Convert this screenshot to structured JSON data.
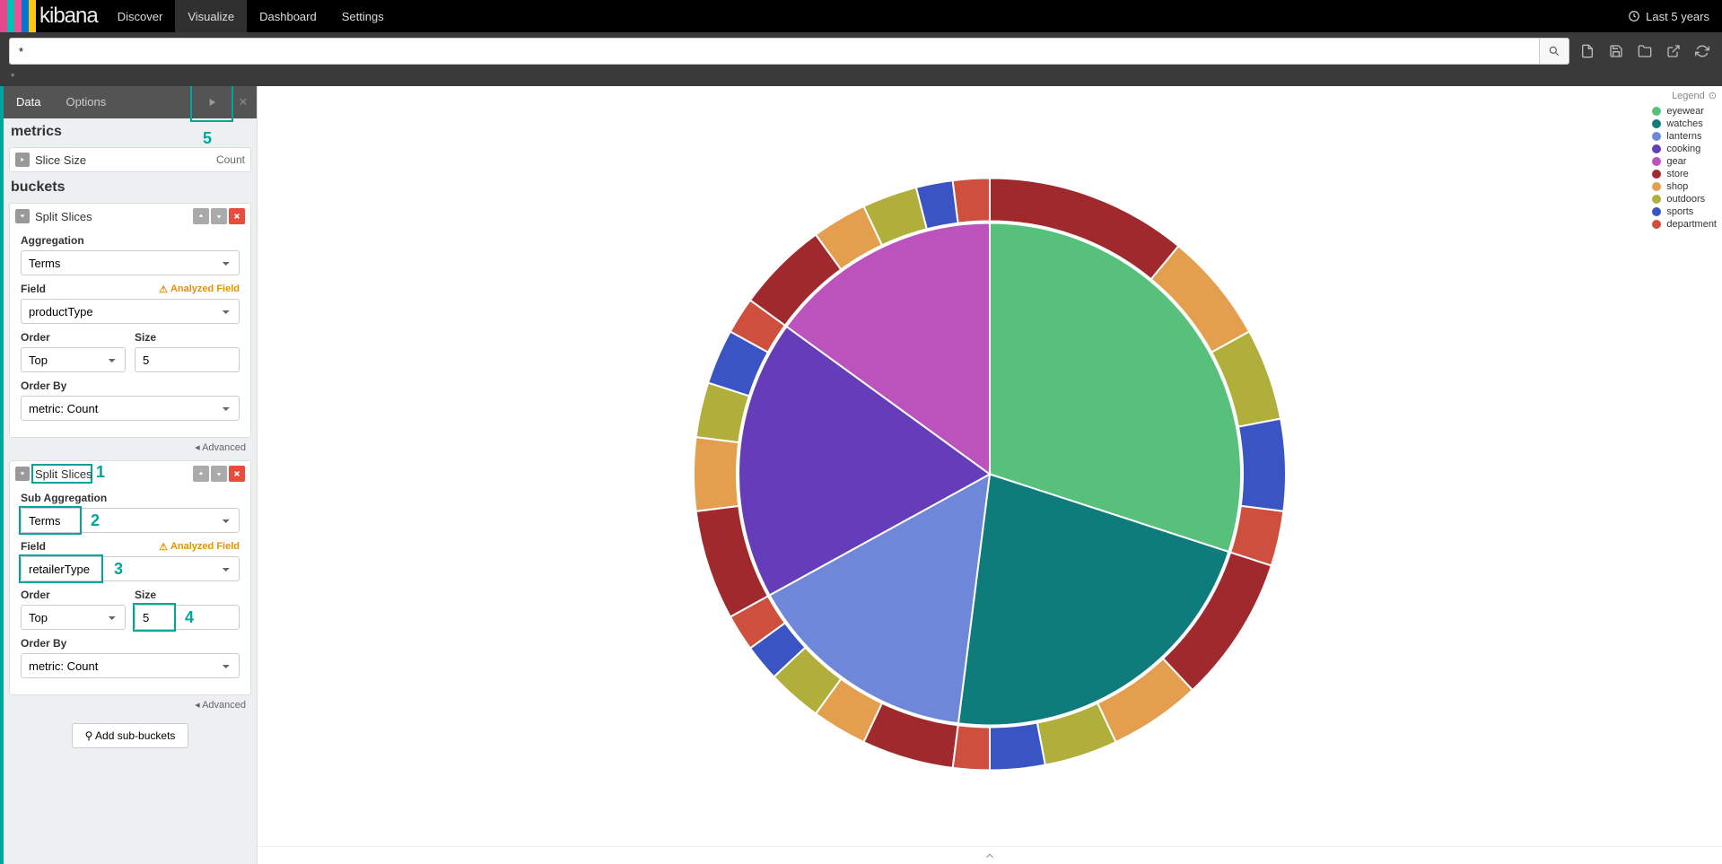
{
  "nav": {
    "items": [
      "Discover",
      "Visualize",
      "Dashboard",
      "Settings"
    ],
    "active": 1,
    "time_label": "Last 5 years"
  },
  "search": {
    "query": "*",
    "placeholder": ""
  },
  "label": "*",
  "side_tabs": {
    "data": "Data",
    "options": "Options"
  },
  "metrics": {
    "header": "metrics",
    "slice_size": "Slice Size",
    "count": "Count"
  },
  "buckets": {
    "header": "buckets",
    "agg1": {
      "title": "Split Slices",
      "aggregation_label": "Aggregation",
      "aggregation": "Terms",
      "field_label": "Field",
      "field_warning": "Analyzed Field",
      "field": "productType",
      "order_label": "Order",
      "order": "Top",
      "size_label": "Size",
      "size": "5",
      "orderby_label": "Order By",
      "orderby": "metric: Count",
      "advanced": "Advanced"
    },
    "agg2": {
      "title": "Split Slices",
      "aggregation_label": "Sub Aggregation",
      "aggregation": "Terms",
      "field_label": "Field",
      "field_warning": "Analyzed Field",
      "field": "retailerType",
      "order_label": "Order",
      "order": "Top",
      "size_label": "Size",
      "size": "5",
      "orderby_label": "Order By",
      "orderby": "metric: Count",
      "advanced": "Advanced"
    },
    "add_sub": "Add sub-buckets"
  },
  "legend": {
    "title": "Legend",
    "items": [
      {
        "label": "eyewear",
        "color": "#57c17b"
      },
      {
        "label": "watches",
        "color": "#0e7c7b"
      },
      {
        "label": "lanterns",
        "color": "#6f87d8"
      },
      {
        "label": "cooking",
        "color": "#663db8"
      },
      {
        "label": "gear",
        "color": "#bc52bc"
      },
      {
        "label": "store",
        "color": "#a0292e"
      },
      {
        "label": "shop",
        "color": "#e39e4e"
      },
      {
        "label": "outdoors",
        "color": "#b0af3b"
      },
      {
        "label": "sports",
        "color": "#3b54c4"
      },
      {
        "label": "department",
        "color": "#cf4f3e"
      }
    ]
  },
  "annotations": {
    "n1": "1",
    "n2": "2",
    "n3": "3",
    "n4": "4",
    "n5": "5"
  },
  "chart_data": {
    "type": "pie",
    "rings": 2,
    "inner": {
      "description": "productType terms",
      "slices": [
        {
          "label": "eyewear",
          "value": 30,
          "color": "#57c17b"
        },
        {
          "label": "watches",
          "value": 22,
          "color": "#0e7c7b"
        },
        {
          "label": "lanterns",
          "value": 15,
          "color": "#6f87d8"
        },
        {
          "label": "cooking",
          "value": 18,
          "color": "#663db8"
        },
        {
          "label": "gear",
          "value": 15,
          "color": "#bc52bc"
        }
      ]
    },
    "outer": {
      "description": "retailerType sub-aggregation per inner slice (Top 5 each)",
      "palette": [
        "#a0292e",
        "#e39e4e",
        "#b0af3b",
        "#3b54c4",
        "#cf4f3e"
      ],
      "groups": [
        {
          "parent": "eyewear",
          "values": [
            11,
            6,
            5,
            5,
            3
          ]
        },
        {
          "parent": "watches",
          "values": [
            8,
            5,
            4,
            3,
            2
          ]
        },
        {
          "parent": "lanterns",
          "values": [
            5,
            3,
            3,
            2,
            2
          ]
        },
        {
          "parent": "cooking",
          "values": [
            6,
            4,
            3,
            3,
            2
          ]
        },
        {
          "parent": "gear",
          "values": [
            5,
            3,
            3,
            2,
            2
          ]
        }
      ]
    }
  }
}
